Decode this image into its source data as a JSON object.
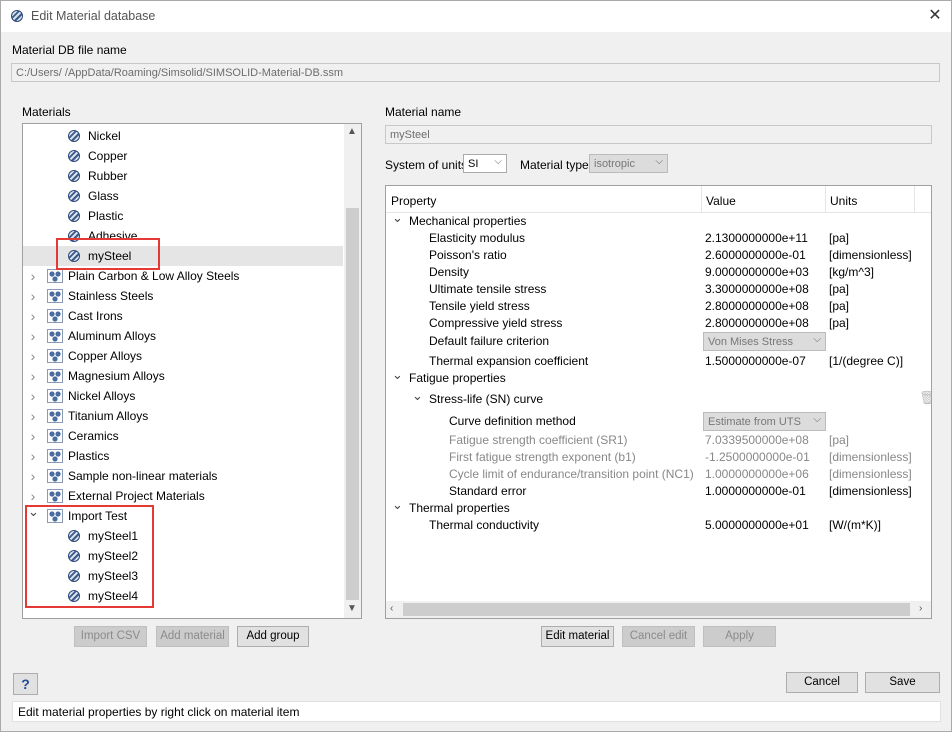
{
  "window": {
    "title": "Edit Material database"
  },
  "db": {
    "label": "Material DB file name",
    "path": "C:/Users/         /AppData/Roaming/Simsolid/SIMSOLID-Material-DB.ssm"
  },
  "materials": {
    "label": "Materials",
    "builtin_items": [
      "Nickel",
      "Copper",
      "Rubber",
      "Glass",
      "Plastic",
      "Adhesive"
    ],
    "selected_item": "mySteel",
    "groups": [
      "Plain Carbon & Low Alloy Steels",
      "Stainless Steels",
      "Cast Irons",
      "Aluminum Alloys",
      "Copper Alloys",
      "Magnesium Alloys",
      "Nickel Alloys",
      "Titanium Alloys",
      "Ceramics",
      "Plastics",
      "Sample non-linear materials",
      "External Project Materials"
    ],
    "import_group": "Import Test",
    "import_items": [
      "mySteel1",
      "mySteel2",
      "mySteel3",
      "mySteel4"
    ],
    "buttons": {
      "import_csv": "Import CSV",
      "add_material": "Add material",
      "add_group": "Add group"
    }
  },
  "detail": {
    "name_label": "Material name",
    "name_value": "mySteel",
    "units_label": "System of units",
    "units_value": "SI",
    "type_label": "Material type",
    "type_value": "isotropic"
  },
  "props": {
    "headers": {
      "property": "Property",
      "value": "Value",
      "units": "Units"
    },
    "mech_section": "Mechanical properties",
    "mech": [
      {
        "name": "Elasticity modulus",
        "value": "2.1300000000e+11",
        "unit": "[pa]"
      },
      {
        "name": "Poisson's ratio",
        "value": "2.6000000000e-01",
        "unit": "[dimensionless]"
      },
      {
        "name": "Density",
        "value": "9.0000000000e+03",
        "unit": "[kg/m^3]"
      },
      {
        "name": "Ultimate tensile stress",
        "value": "3.3000000000e+08",
        "unit": "[pa]"
      },
      {
        "name": "Tensile yield stress",
        "value": "2.8000000000e+08",
        "unit": "[pa]"
      },
      {
        "name": "Compressive yield stress",
        "value": "2.8000000000e+08",
        "unit": "[pa]"
      }
    ],
    "failure_name": "Default failure criterion",
    "failure_value": "Von Mises Stress",
    "thermal_exp": {
      "name": "Thermal expansion coefficient",
      "value": "1.5000000000e-07",
      "unit": "[1/(degree C)]"
    },
    "fatigue_section": "Fatigue properties",
    "sn_section": "Stress-life (SN) curve",
    "curve_name": "Curve definition method",
    "curve_value": "Estimate from UTS",
    "fatigue_rows": [
      {
        "name": "Fatigue strength coefficient (SR1)",
        "value": "7.0339500000e+08",
        "unit": "[pa]"
      },
      {
        "name": "First fatigue strength exponent (b1)",
        "value": "-1.2500000000e-01",
        "unit": "[dimensionless]"
      },
      {
        "name": "Cycle limit of endurance/transition point (NC1)",
        "value": "1.0000000000e+06",
        "unit": "[dimensionless]"
      }
    ],
    "std_error": {
      "name": "Standard error",
      "value": "1.0000000000e-01",
      "unit": "[dimensionless]"
    },
    "thermal_section": "Thermal properties",
    "thermal_cond": {
      "name": "Thermal conductivity",
      "value": "5.0000000000e+01",
      "unit": "[W/(m*K)]"
    }
  },
  "detail_buttons": {
    "edit": "Edit material",
    "cancel": "Cancel edit",
    "apply": "Apply"
  },
  "footer": {
    "help": "?",
    "cancel": "Cancel",
    "save": "Save",
    "status": "Edit material properties by right click on material item"
  }
}
